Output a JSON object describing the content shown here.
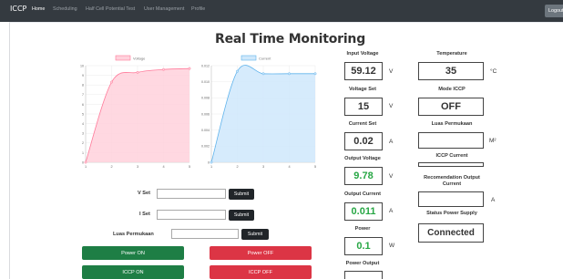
{
  "navbar": {
    "brand": "ICCP",
    "links": [
      "Home",
      "Scheduling",
      "Half Cell Potential Test",
      "User Management",
      "Profile"
    ],
    "logout_label": "Logout"
  },
  "page_title": "Real Time Monitoring",
  "charts": {
    "voltage": {
      "legend": "Voltage",
      "color_fill": "#ffd1dc",
      "color_line": "#ff7a9a",
      "chart_data": {
        "type": "area",
        "x": [
          1,
          2,
          3,
          4,
          5
        ],
        "values": [
          0,
          8.3,
          9.3,
          9.6,
          9.7
        ],
        "x_ticks": [
          "1",
          "2",
          "3",
          "4",
          "5"
        ],
        "y_ticks": [
          "0",
          "1",
          "2",
          "3",
          "4",
          "5",
          "6",
          "7",
          "8",
          "9",
          "10"
        ],
        "ylim": [
          0,
          10
        ],
        "grid": true,
        "legend_position": "top"
      }
    },
    "current": {
      "legend": "Current",
      "color_fill": "#cfe8fb",
      "color_line": "#5fb3ec",
      "chart_data": {
        "type": "area",
        "x": [
          1,
          2,
          3,
          4,
          5
        ],
        "values": [
          0,
          0.0113,
          0.011,
          0.011,
          0.011
        ],
        "x_ticks": [
          "1",
          "2",
          "3",
          "4",
          "5"
        ],
        "y_ticks": [
          "0",
          "0.002",
          "0.004",
          "0.006",
          "0.008",
          "0.010",
          "0.012"
        ],
        "ylim": [
          0,
          0.012
        ],
        "grid": true,
        "legend_position": "top"
      }
    }
  },
  "form": {
    "vset_label": "V Set",
    "iset_label": "I Set",
    "luas_label": "Luas Permukaan",
    "submit_label": "Submit"
  },
  "buttons": {
    "power_on": "Power ON",
    "power_off": "Power OFF",
    "iccp_on": "ICCP ON",
    "iccp_off": "ICCP OFF"
  },
  "metrics_left": {
    "input_voltage": {
      "label": "Input Voltage",
      "value": "59.12",
      "unit": "V"
    },
    "voltage_set": {
      "label": "Voltage Set",
      "value": "15",
      "unit": "V"
    },
    "current_set": {
      "label": "Current Set",
      "value": "0.02",
      "unit": "A"
    },
    "output_voltage": {
      "label": "Output Voltage",
      "value": "9.78",
      "unit": "V"
    },
    "output_current": {
      "label": "Output Current",
      "value": "0.011",
      "unit": "A"
    },
    "power": {
      "label": "Power",
      "value": "0.1",
      "unit": "W"
    },
    "power_output": {
      "label": "Power Output"
    }
  },
  "metrics_right": {
    "temperature": {
      "label": "Temperature",
      "value": "35",
      "unit": "°C"
    },
    "mode_iccp": {
      "label": "Mode ICCP",
      "value": "OFF"
    },
    "luas_permukaan": {
      "label": "Luas Permukaan",
      "value": "",
      "unit": "M²"
    },
    "iccp_current": {
      "label": "ICCP Current",
      "value": ""
    },
    "recomendation": {
      "label": "Recomendation Output Current",
      "value": "",
      "unit": "A"
    },
    "status_power_supply": {
      "label": "Status Power Supply",
      "value": "Connected"
    }
  }
}
